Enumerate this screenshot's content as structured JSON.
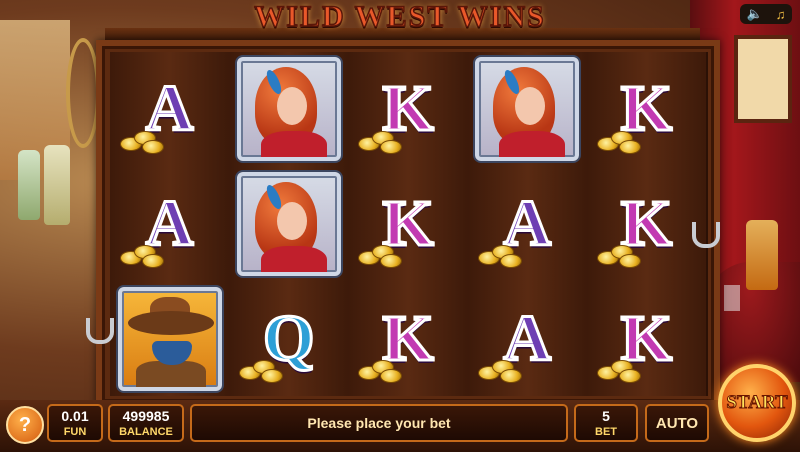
{
  "title": "WILD WEST WINS",
  "system_controls": {
    "sound_icon": "speaker-icon",
    "music_icon": "music-note-icon"
  },
  "reels": [
    [
      "A",
      "LADY",
      "K",
      "LADY",
      "K"
    ],
    [
      "A",
      "LADY",
      "K",
      "A",
      "K"
    ],
    [
      "COWBOY",
      "Q",
      "K",
      "A",
      "K"
    ]
  ],
  "controls": {
    "help_label": "?",
    "coin_value": "0.01",
    "coin_label": "FUN",
    "balance_value": "499985",
    "balance_label": "BALANCE",
    "message": "Please place your bet",
    "bet_value": "5",
    "bet_label": "BET",
    "auto_label": "AUTO",
    "start_label": "START"
  },
  "colors": {
    "accent": "#e2560e",
    "panel_border": "#c56a1a",
    "text_gold": "#ffd86a"
  }
}
